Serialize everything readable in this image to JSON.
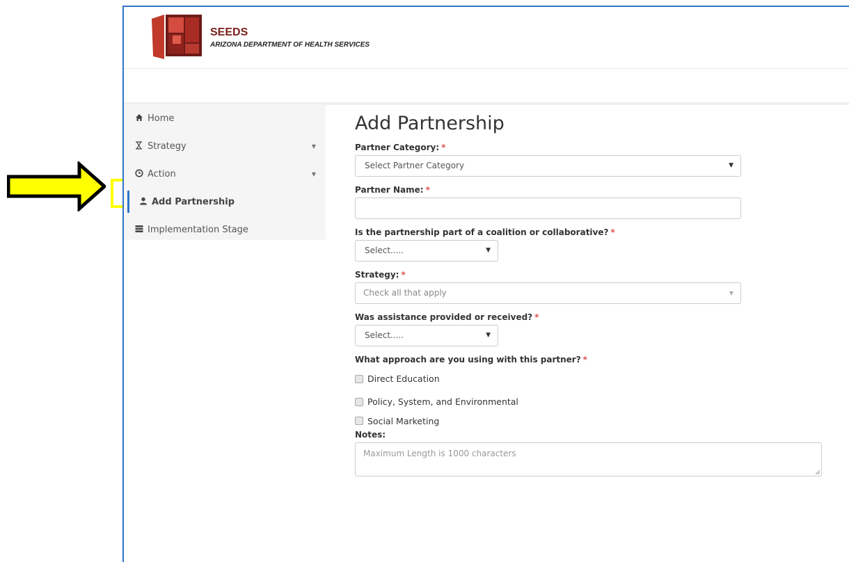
{
  "header": {
    "brand_name": "SEEDS",
    "brand_subtitle": "ARIZONA DEPARTMENT OF HEALTH SERVICES"
  },
  "sidebar": {
    "items": [
      {
        "label": "Home",
        "icon": "home-icon"
      },
      {
        "label": "Strategy",
        "icon": "hourglass-icon",
        "has_caret": true
      },
      {
        "label": "Action",
        "icon": "clock-icon",
        "has_caret": true
      },
      {
        "label": "Add Partnership",
        "icon": "user-icon",
        "active": true
      },
      {
        "label": "Implementation Stage",
        "icon": "server-icon"
      }
    ]
  },
  "form": {
    "title": "Add Partnership",
    "partner_category": {
      "label": "Partner Category:",
      "value": "Select Partner Category"
    },
    "partner_name": {
      "label": "Partner Name:",
      "value": ""
    },
    "coalition": {
      "label": "Is the partnership part of a coalition or collaborative?",
      "value": "Select....."
    },
    "strategy": {
      "label": "Strategy:",
      "value": "Check all that apply"
    },
    "assistance": {
      "label": "Was assistance provided or received?",
      "value": "Select....."
    },
    "approach": {
      "label": "What approach are you using with this partner?",
      "options": [
        "Direct Education",
        "Policy, System, and Environmental",
        "Social Marketing"
      ]
    },
    "notes": {
      "label": "Notes:",
      "placeholder": "Maximum Length is 1000 characters"
    },
    "required_mark": "*"
  },
  "colors": {
    "brand_dark_red": "#7a1f1a",
    "required": "#d9534f",
    "active_bar": "#2c74c6",
    "callout": "#ffff00"
  }
}
